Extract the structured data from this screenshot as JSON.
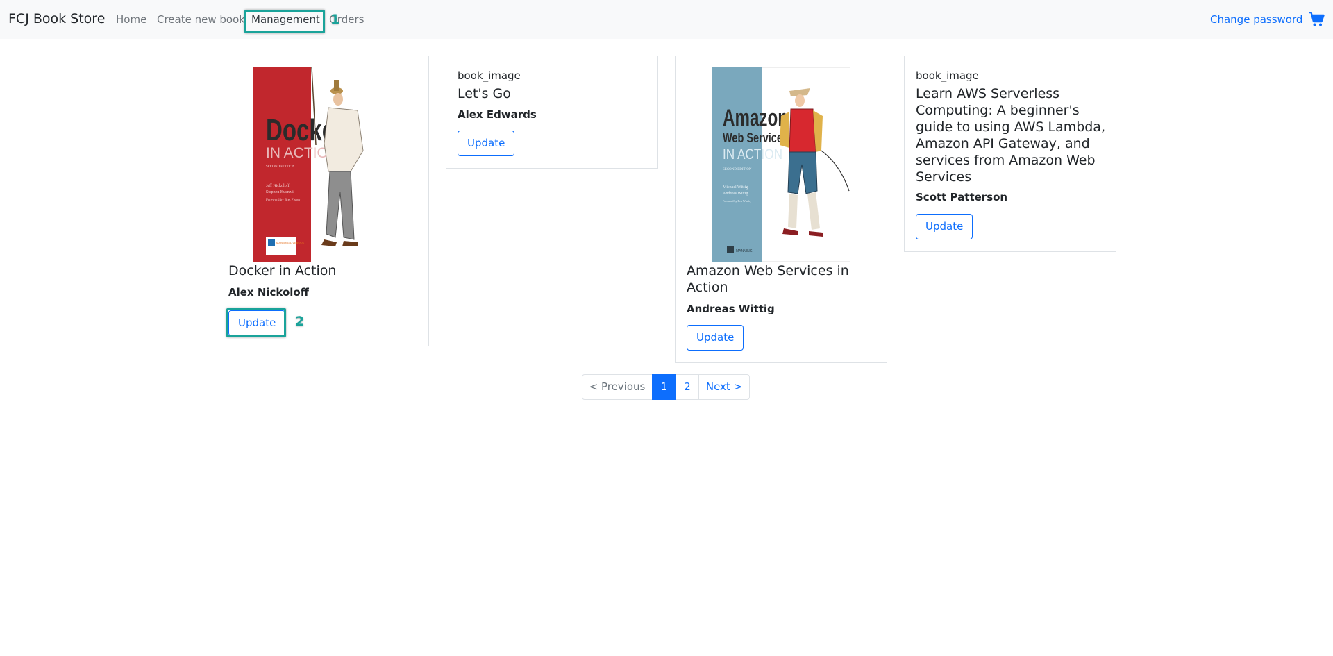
{
  "navbar": {
    "brand": "FCJ Book Store",
    "links": [
      "Home",
      "Create new book",
      "Management",
      "Orders"
    ],
    "change_password": "Change password",
    "cart_icon": "shopping-cart-icon"
  },
  "annotations": {
    "callout_1": "1",
    "callout_2": "2",
    "accent": "#1aa39a"
  },
  "books": [
    {
      "title": "Docker in Action",
      "author": "Alex Nickoloff",
      "update": "Update",
      "cover": {
        "title_line1": "Docker",
        "title_line2": "IN ACTION",
        "edition": "SECOND EDITION",
        "authors": [
          "Jeff Nickoloff",
          "Stephen Kuenzli"
        ],
        "foreword": "Foreword by Bret Fisher",
        "badge": "MANNING LIVEBOOK"
      }
    },
    {
      "title": "Let's Go",
      "author": "Alex Edwards",
      "update": "Update",
      "image_alt": "book_image"
    },
    {
      "title": "Amazon Web Services in Action",
      "author": "Andreas Wittig",
      "update": "Update",
      "cover": {
        "title_line1": "Amazon",
        "title_line2": "Web Services",
        "title_line3": "IN ACTION",
        "edition": "SECOND EDITION",
        "authors": [
          "Michael Wittig",
          "Andreas Wittig"
        ],
        "foreword": "Foreword by Ben Whaley",
        "publisher": "MANNING"
      }
    },
    {
      "title": "Learn AWS Serverless Computing: A beginner's guide to using AWS Lambda, Amazon API Gateway, and services from Amazon Web Services",
      "title_lines": [
        "Learn AWS Serverless",
        "Computing: A beginner's",
        "guide to using AWS Lambda,",
        "Amazon API Gateway, and",
        "services from Amazon Web",
        "Services"
      ],
      "author": "Scott Patterson",
      "update": "Update",
      "image_alt": "book_image"
    }
  ],
  "pagination": {
    "previous": "< Previous",
    "pages": [
      "1",
      "2"
    ],
    "active": "1",
    "next": "Next >"
  },
  "colors": {
    "primary": "#0d6efd",
    "navbar_bg": "#f8f9fa",
    "border": "#dee2e6",
    "docker_red": "#c1272d",
    "aws_teal": "#7aa8bd"
  }
}
